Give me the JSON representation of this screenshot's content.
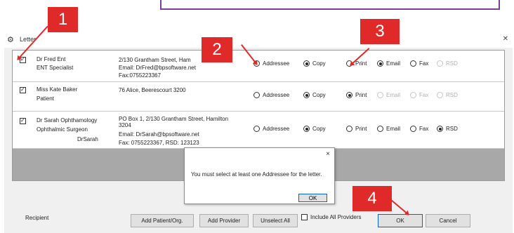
{
  "window": {
    "title": "Letter"
  },
  "recipients": [
    {
      "name": "Dr Fred Ent",
      "role": "ENT Specialist",
      "alias": "",
      "address_lines": [
        "2/130 Grantham Street, Ham",
        "Email: DrFred@bpsoftware.net",
        "Fax:0755223367"
      ],
      "checked": true,
      "options": [
        {
          "label": "Addressee",
          "selected": false,
          "enabled": true
        },
        {
          "label": "Copy",
          "selected": true,
          "enabled": true
        },
        {
          "label": "Print",
          "selected": false,
          "enabled": true
        },
        {
          "label": "Email",
          "selected": true,
          "enabled": true
        },
        {
          "label": "Fax",
          "selected": false,
          "enabled": true
        },
        {
          "label": "RSD",
          "selected": false,
          "enabled": false
        }
      ]
    },
    {
      "name": "Miss Kate Baker",
      "role": "Patient",
      "alias": "",
      "address_lines": [
        "76 Alice, Beerescourt 3200"
      ],
      "checked": true,
      "options": [
        {
          "label": "Addressee",
          "selected": false,
          "enabled": true
        },
        {
          "label": "Copy",
          "selected": true,
          "enabled": true
        },
        {
          "label": "Print",
          "selected": true,
          "enabled": true
        },
        {
          "label": "Email",
          "selected": false,
          "enabled": false
        },
        {
          "label": "Fax",
          "selected": false,
          "enabled": false
        },
        {
          "label": "RSD",
          "selected": false,
          "enabled": false
        }
      ]
    },
    {
      "name": "Dr Sarah Ophthamology",
      "role": "Ophthalmic Surgeon",
      "alias": "DrSarah",
      "address_lines": [
        "PO Box 1, 2/130 Grantham Street, Hamilton",
        "3204",
        "Email: DrSarah@bpsoftware.net",
        "Fax: 0755223367, RSD: 123123"
      ],
      "checked": true,
      "options": [
        {
          "label": "Addressee",
          "selected": false,
          "enabled": true
        },
        {
          "label": "Copy",
          "selected": true,
          "enabled": true
        },
        {
          "label": "Print",
          "selected": false,
          "enabled": true
        },
        {
          "label": "Email",
          "selected": false,
          "enabled": true
        },
        {
          "label": "Fax",
          "selected": false,
          "enabled": true
        },
        {
          "label": "RSD",
          "selected": true,
          "enabled": true
        }
      ]
    }
  ],
  "dialog": {
    "close": "×",
    "message": "You must select at least one Addressee for the letter.",
    "ok_label": "OK"
  },
  "footer": {
    "recipient_label": "Recipient",
    "add_patient_label": "Add Patient/Org.",
    "add_provider_label": "Add Provider",
    "unselect_all_label": "Unselect All",
    "include_all_label": "Include All Providers",
    "ok_label": "OK",
    "cancel_label": "Cancel"
  },
  "callouts": [
    "1",
    "2",
    "3",
    "4"
  ],
  "colors": {
    "callout": "#e02a2a",
    "top_note_border": "#7b3f98"
  }
}
